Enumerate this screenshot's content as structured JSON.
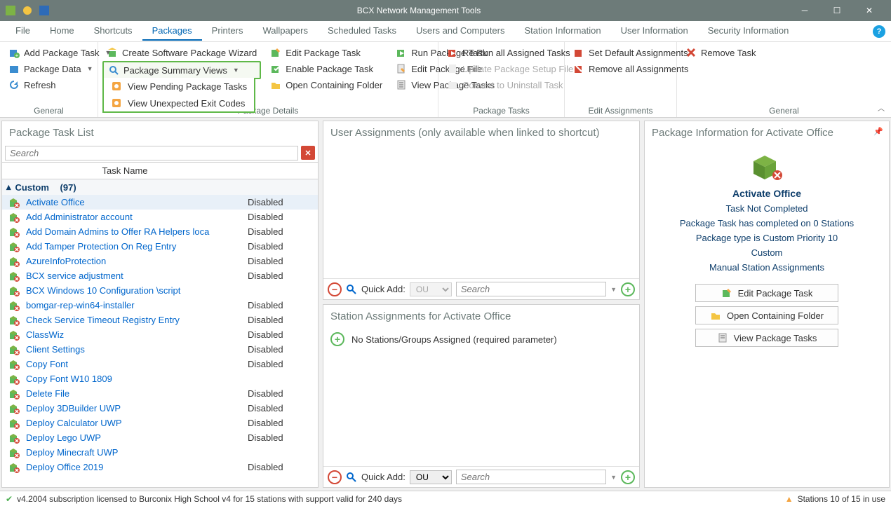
{
  "window": {
    "title": "BCX Network Management Tools"
  },
  "menu": {
    "items": [
      "File",
      "Home",
      "Shortcuts",
      "Packages",
      "Printers",
      "Wallpapers",
      "Scheduled Tasks",
      "Users and Computers",
      "Station Information",
      "User Information",
      "Security Information"
    ],
    "active": "Packages"
  },
  "ribbon": {
    "general": {
      "label": "General",
      "add_package_task": "Add Package Task",
      "package_data": "Package Data",
      "refresh": "Refresh"
    },
    "details": {
      "label": "Package Details",
      "create_wizard": "Create Software Package Wizard",
      "summary_views": "Package Summary Views",
      "summary_menu": {
        "pending": "View Pending Package Tasks",
        "exit_codes": "View Unexpected Exit Codes"
      },
      "edit_task": "Edit Package Task",
      "enable_task": "Enable Package Task",
      "open_folder": "Open Containing Folder",
      "run_task": "Run Package Task",
      "edit_file": "Edit Package File",
      "view_tasks": "View Package Tasks"
    },
    "tasks": {
      "label": "Package Tasks",
      "rerun": "Re Run all Assigned Tasks",
      "update_setup": "Update Package Setup File",
      "convert_uninstall": "Convert to Uninstall Task"
    },
    "edit_assign": {
      "label": "Edit Assignments",
      "set_default": "Set Default Assignments",
      "remove_all": "Remove all Assignments"
    },
    "general2": {
      "label": "General",
      "remove_task": "Remove Task"
    }
  },
  "left": {
    "title": "Package Task List",
    "search_placeholder": "Search",
    "header_name": "Task Name",
    "group": {
      "name": "Custom",
      "count": "(97)"
    },
    "tasks": [
      {
        "name": "Activate Office",
        "status": "Disabled",
        "selected": true
      },
      {
        "name": "Add Administrator account",
        "status": "Disabled"
      },
      {
        "name": "Add Domain Admins to Offer RA Helpers loca",
        "status": "Disabled"
      },
      {
        "name": "Add Tamper Protection On Reg Entry",
        "status": "Disabled"
      },
      {
        "name": "AzureInfoProtection",
        "status": "Disabled"
      },
      {
        "name": "BCX service adjustment",
        "status": "Disabled"
      },
      {
        "name": "BCX Windows 10 Configuration \\script",
        "status": ""
      },
      {
        "name": "bomgar-rep-win64-installer",
        "status": "Disabled"
      },
      {
        "name": "Check Service Timeout Registry Entry",
        "status": "Disabled"
      },
      {
        "name": "ClassWiz",
        "status": "Disabled"
      },
      {
        "name": "Client Settings",
        "status": "Disabled"
      },
      {
        "name": "Copy Font",
        "status": "Disabled"
      },
      {
        "name": "Copy Font W10 1809",
        "status": ""
      },
      {
        "name": "Delete File",
        "status": "Disabled"
      },
      {
        "name": "Deploy 3DBuilder UWP",
        "status": "Disabled"
      },
      {
        "name": "Deploy Calculator UWP",
        "status": "Disabled"
      },
      {
        "name": "Deploy Lego UWP",
        "status": "Disabled"
      },
      {
        "name": "Deploy Minecraft UWP",
        "status": ""
      },
      {
        "name": "Deploy Office 2019",
        "status": "Disabled"
      }
    ]
  },
  "center": {
    "user_title": "User Assignments (only available when linked to shortcut)",
    "station_title": "Station Assignments for Activate Office",
    "station_msg": "No Stations/Groups Assigned (required parameter)",
    "quickadd_label": "Quick Add:",
    "quickadd_select": "OU",
    "quickadd_search": "Search"
  },
  "right": {
    "title": "Package Information for Activate Office",
    "pkg_name": "Activate Office",
    "line1": "Task Not Completed",
    "line2": "Package Task has completed on 0 Stations",
    "line3": "Package type is Custom Priority 10",
    "line3b": "Custom",
    "line4": "Manual Station Assignments",
    "btn_edit": "Edit Package Task",
    "btn_folder": "Open Containing Folder",
    "btn_view": "View Package Tasks"
  },
  "statusbar": {
    "left": "v4.2004 subscription licensed to Burconix High School v4 for 15 stations with support valid for 240 days",
    "right": "Stations 10 of 15 in use"
  }
}
